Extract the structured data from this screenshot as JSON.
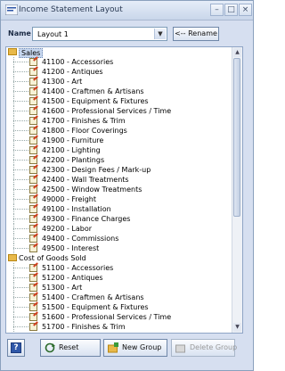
{
  "window": {
    "title": "Income Statement Layout"
  },
  "title_controls": {
    "minimize": "–",
    "maximize": "□",
    "close": "×"
  },
  "name_field": {
    "label": "Name",
    "value": "Layout 1"
  },
  "rename_button": "<-- Rename",
  "tree": {
    "groups": [
      {
        "label": "Sales",
        "selected": true,
        "items": [
          "41100 - Accessories",
          "41200 - Antiques",
          "41300 - Art",
          "41400 - Craftmen & Artisans",
          "41500 - Equipment & Fixtures",
          "41600 - Professional Services / Time",
          "41700 - Finishes & Trim",
          "41800 - Floor Coverings",
          "41900 - Furniture",
          "42100 - Lighting",
          "42200 - Plantings",
          "42300 - Design Fees / Mark-up",
          "42400 - Wall Treatments",
          "42500 - Window Treatments",
          "49000 - Freight",
          "49100 - Installation",
          "49300 - Finance Charges",
          "49200 - Labor",
          "49400 - Commissions",
          "49500 - Interest"
        ]
      },
      {
        "label": "Cost of Goods Sold",
        "selected": false,
        "items": [
          "51100 - Accessories",
          "51200 - Antiques",
          "51300 - Art",
          "51400 - Craftmen & Artisans",
          "51500 - Equipment & Fixtures",
          "51600 - Professional Services / Time",
          "51700 - Finishes & Trim"
        ]
      }
    ]
  },
  "buttons": {
    "help": "?",
    "reset": "Reset",
    "new_group": "New Group",
    "delete_group": "Delete Group"
  }
}
